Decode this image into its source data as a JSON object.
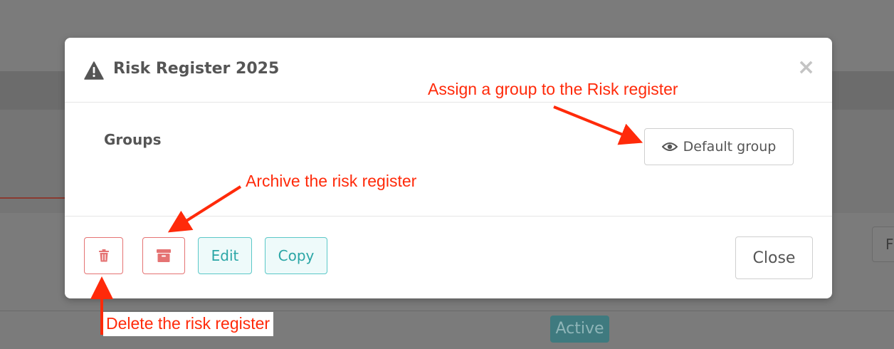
{
  "modal": {
    "title": "Risk Register 2025",
    "title_icon": "warning-triangle-icon",
    "close_glyph": "×",
    "groups_label": "Groups",
    "group_button": {
      "label": "Default group",
      "icon": "eye-icon"
    },
    "footer": {
      "delete_icon": "trash-icon",
      "archive_icon": "archive-box-icon",
      "edit_label": "Edit",
      "copy_label": "Copy",
      "close_label": "Close"
    }
  },
  "background": {
    "status_badge": "Active",
    "partial_button_text": "F"
  },
  "annotations": {
    "assign_group": "Assign a group to the Risk register",
    "archive": "Archive the risk register",
    "delete": "Delete the risk register"
  },
  "colors": {
    "annotation_red": "#ff2a0a",
    "danger": "#e57373",
    "info": "#2aa6a6",
    "overlay": "#7b7b7b"
  }
}
